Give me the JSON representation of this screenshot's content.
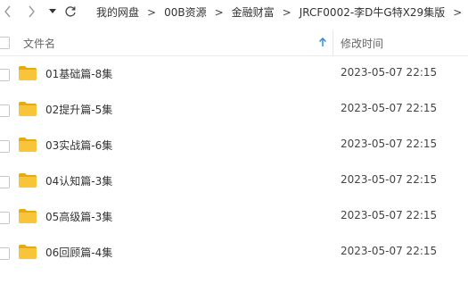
{
  "toolbar": {
    "back_icon": "chevron-left-icon",
    "forward_icon": "chevron-right-icon",
    "dropdown_icon": "caret-down-icon",
    "refresh_icon": "refresh-icon"
  },
  "breadcrumb": {
    "items": [
      {
        "label": "我的网盘"
      },
      {
        "label": "00B资源"
      },
      {
        "label": "金融财富"
      },
      {
        "label": "JRCF0002-李D牛G特X29集版"
      }
    ],
    "separator": ">"
  },
  "columns": {
    "name": "文件名",
    "modified": "修改时间",
    "sort_icon": "arrow-up-icon",
    "sort_color": "#1e88e5"
  },
  "folder_color": "#f8c53a",
  "files": [
    {
      "name": "01基础篇-8集",
      "modified": "2023-05-07 22:15"
    },
    {
      "name": "02提升篇-5集",
      "modified": "2023-05-07 22:15"
    },
    {
      "name": "03实战篇-6集",
      "modified": "2023-05-07 22:15"
    },
    {
      "name": "04认知篇-3集",
      "modified": "2023-05-07 22:15"
    },
    {
      "name": "05高级篇-3集",
      "modified": "2023-05-07 22:15"
    },
    {
      "name": "06回顾篇-4集",
      "modified": "2023-05-07 22:15"
    }
  ]
}
